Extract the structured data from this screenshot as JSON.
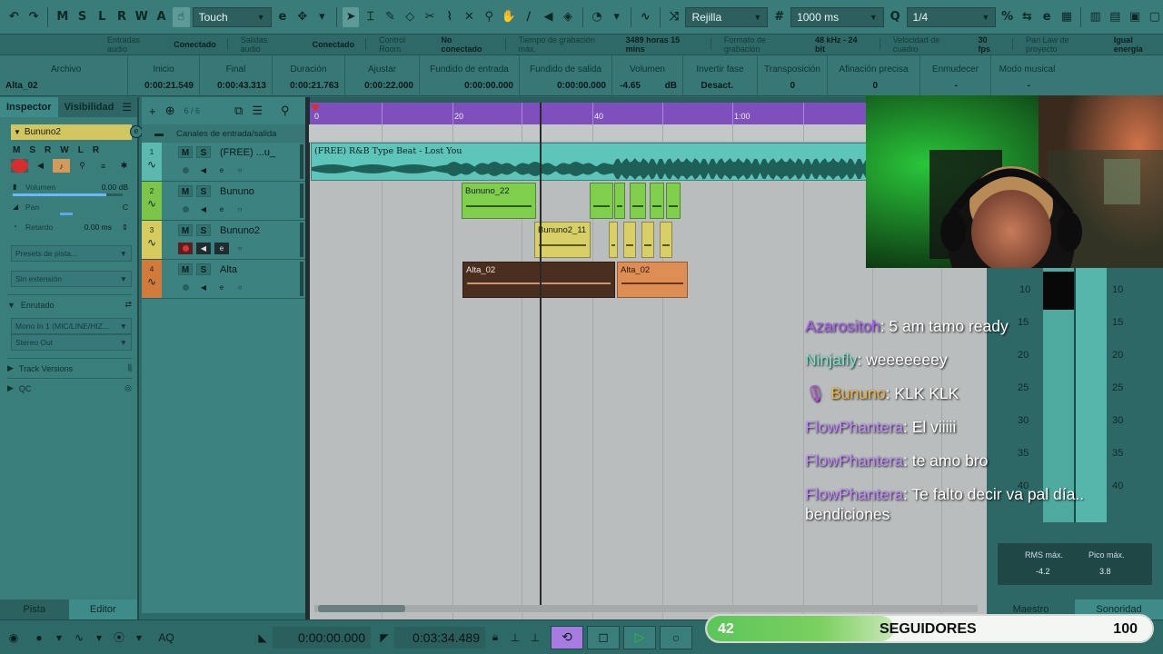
{
  "toolbar": {
    "mode_letters": [
      "M",
      "S",
      "L",
      "R",
      "W",
      "A"
    ],
    "tool_mode": "Touch",
    "snap": "Rejilla",
    "nudge": "1000 ms",
    "quantize": "1/4"
  },
  "status": {
    "audio_inputs_label": "Entradas audio",
    "audio_inputs_value": "Conectado",
    "audio_outputs_label": "Salidas audio",
    "audio_outputs_value": "Conectado",
    "control_room_label": "Control Room",
    "control_room_value": "No conectado",
    "rec_time_label": "Tiempo de grabación máx.",
    "rec_time_value": "3489 horas 15 mins",
    "rec_format_label": "Formato de grabación",
    "rec_format_value": "48 kHz - 24 bit",
    "fps_label": "Velocidad de cuadro",
    "fps_value": "30 fps",
    "panlaw_label": "Pan Law de proyecto",
    "panlaw_value": "Igual energía"
  },
  "infoline": {
    "file_label": "Archivo",
    "file_value": "Alta_02",
    "start_label": "Inicio",
    "start_value": "0:00:21.549",
    "end_label": "Final",
    "end_value": "0:00:43.313",
    "length_label": "Duración",
    "length_value": "0:00:21.763",
    "offset_label": "Ajustar",
    "offset_value": "0:00:22.000",
    "fadein_label": "Fundido de entrada",
    "fadein_value": "0:00:00.000",
    "fadeout_label": "Fundido de salida",
    "fadeout_value": "0:00:00.000",
    "volume_label": "Volumen",
    "volume_value": "-4.65",
    "volume_unit": "dB",
    "invert_label": "Invertir fase",
    "invert_value": "Desact.",
    "transpose_label": "Transposición",
    "transpose_value": "0",
    "finetune_label": "Afinación precisa",
    "finetune_value": "0",
    "mute_label": "Enmudecer",
    "mute_value": "-",
    "musical_label": "Modo musical",
    "musical_value": "-"
  },
  "inspector": {
    "tab_inspector": "Inspector",
    "tab_visibility": "Visibilidad",
    "track_name": "Bununo2",
    "msr": [
      "M",
      "S",
      "R",
      "W",
      "L",
      "R"
    ],
    "volume_label": "Volumen",
    "volume_value": "0.00 dB",
    "pan_label": "Pan",
    "pan_value": "C",
    "delay_label": "Retardo",
    "delay_value": "0.00 ms",
    "preset": "Presets de pista...",
    "extension": "Sin extensión",
    "routing": "Enrutado",
    "input": "Mono In 1 (MIC/LINE/HIZ...",
    "output": "Stereo Out",
    "track_versions": "Track Versions",
    "qc": "QC",
    "foot_track": "Pista",
    "foot_editor": "Editor"
  },
  "tracklist": {
    "count": "6 / 6",
    "folder_name": "Canales de entrada/salida",
    "tracks": [
      {
        "num": "1",
        "name": "(FREE) ...u_",
        "color": "#5cb9b0"
      },
      {
        "num": "2",
        "name": "Bununo",
        "color": "#7cc44a"
      },
      {
        "num": "3",
        "name": "Bununo2",
        "color": "#d6cb5e"
      },
      {
        "num": "4",
        "name": "Alta",
        "color": "#d07a3c"
      }
    ]
  },
  "arrange": {
    "ruler": [
      "0",
      "20",
      "40",
      "1:00"
    ],
    "clips": [
      {
        "name": "(FREE) R&B Type Beat - Lost You",
        "track": 1
      },
      {
        "name": "Bununo_22",
        "track": 2
      },
      {
        "name": "Bununo2_11",
        "track": 3
      },
      {
        "name": "Alta_02",
        "track": 4
      },
      {
        "name": "Alta_02",
        "track": 4
      }
    ]
  },
  "meters": {
    "scale_left": [
      "10",
      "15",
      "20",
      "25",
      "30",
      "35",
      "40"
    ],
    "scale_right": [
      "10",
      "15",
      "20",
      "25",
      "30",
      "35",
      "40"
    ],
    "rms_label": "RMS máx.",
    "rms_value": "-4.2",
    "peak_label": "Pico máx.",
    "peak_value": "3.8",
    "tab_master": "Maestro",
    "tab_loudness": "Sonoridad"
  },
  "chat": [
    {
      "user": "Azarositoh",
      "color": "#b05cff",
      "msg": ": 5 am tamo ready"
    },
    {
      "user": "Ninjafly",
      "color": "#7fe3cf",
      "msg": ": weeeeeeey"
    },
    {
      "user": "Bununo",
      "color": "#f0b33a",
      "msg": ": KLK KLK",
      "badge": true
    },
    {
      "user": "FlowPhantera",
      "color": "#c38cff",
      "msg": ": El viiiii"
    },
    {
      "user": "FlowPhantera",
      "color": "#c38cff",
      "msg": ": te amo bro"
    },
    {
      "user": "FlowPhantera",
      "color": "#c38cff",
      "msg": ": Te falto decir va pal día.."
    }
  ],
  "chat_continuation": "bendiciones",
  "transport": {
    "left_time": "0:00:00.000",
    "right_time": "0:03:34.489"
  },
  "followers": {
    "current": "42",
    "label": "SEGUIDORES",
    "goal": "100",
    "progress": 0.42
  }
}
